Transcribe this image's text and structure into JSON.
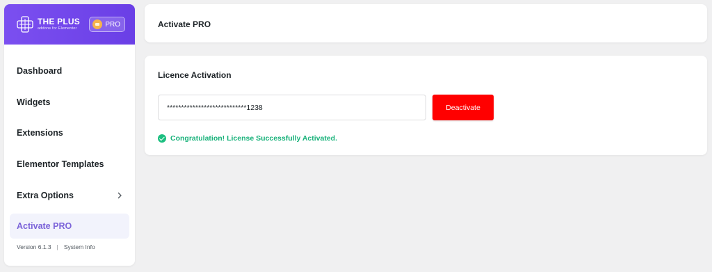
{
  "sidebar": {
    "logo": {
      "title": "THE PLUS",
      "subtitle": "addons for Elementor"
    },
    "pro_badge": "PRO",
    "items": [
      {
        "label": "Dashboard"
      },
      {
        "label": "Widgets"
      },
      {
        "label": "Extensions"
      },
      {
        "label": "Elementor Templates"
      },
      {
        "label": "Extra Options",
        "icon": "chevron-right-icon"
      },
      {
        "label": "Activate PRO",
        "active": true
      }
    ],
    "footer": {
      "version": "Version 6.1.3",
      "separator": "|",
      "system_info": "System Info"
    }
  },
  "header": {
    "title": "Activate PRO"
  },
  "license": {
    "section_title": "Licence Activation",
    "key_value": "****************************1238",
    "button_label": "Deactivate",
    "status_message": "Congratulation! License Successfully Activated."
  },
  "colors": {
    "brand": "#7b4ff0",
    "active_text": "#7b63d9",
    "danger": "#ff0000",
    "success": "#18b27a"
  }
}
